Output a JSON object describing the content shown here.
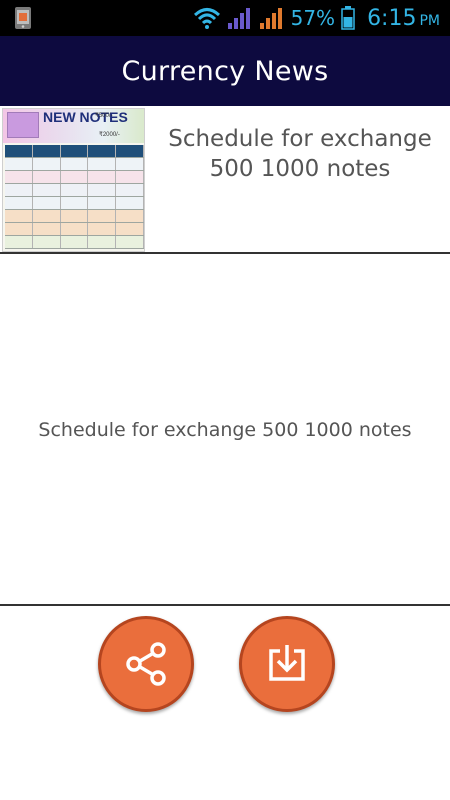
{
  "status_bar": {
    "battery_percent": "57%",
    "time": "6:15",
    "ampm": "PM",
    "icons": [
      "phone-manager-icon",
      "wifi-icon",
      "signal-icon",
      "signal-icon",
      "battery-icon"
    ],
    "color": "#33b5e5"
  },
  "app": {
    "title": "Currency News",
    "accent": "#0d0a3f"
  },
  "news_item": {
    "title": "Schedule for exchange 500 1000 notes",
    "thumbnail": {
      "headline": "NEW NOTES",
      "denomination_1": "₹500/-",
      "denomination_2": "₹2000/-"
    }
  },
  "detail": {
    "text": "Schedule for exchange 500 1000 notes"
  },
  "actions": {
    "share_icon": "share-icon",
    "download_icon": "download-icon",
    "button_color": "#ea6e3c"
  }
}
